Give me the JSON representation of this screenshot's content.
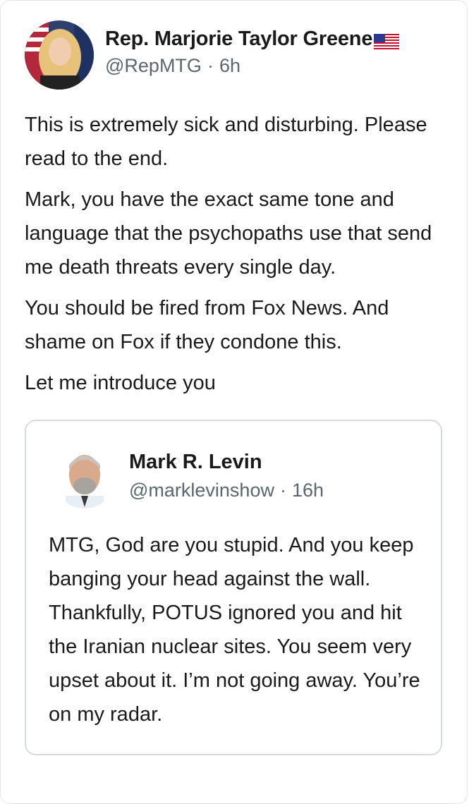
{
  "tweet": {
    "display_name": "Rep. Marjorie Taylor Greene",
    "flag_icon": "us-flag-icon",
    "handle": "@RepMTG",
    "separator": "·",
    "time": "6h",
    "paragraphs": [
      "This is extremely sick and disturbing. Please read to the end.",
      "Mark, you have the exact same tone and language that the psychopaths use that send me death threats every single day.",
      "You should be fired from Fox News. And shame on Fox if they condone this.",
      "Let me introduce you"
    ]
  },
  "quoted_tweet": {
    "display_name": "Mark R. Levin",
    "handle": "@marklevinshow",
    "separator": "·",
    "time": "16h",
    "text": "MTG, God are you stupid. And you keep banging your head against the wall. Thankfully, POTUS ignored you and hit the Iranian nuclear sites. You seem very upset about it.  I’m not going away. You’re on my radar."
  },
  "colors": {
    "text": "#1a1a1a",
    "secondary": "#5b6770",
    "border": "#d6dbe0"
  }
}
